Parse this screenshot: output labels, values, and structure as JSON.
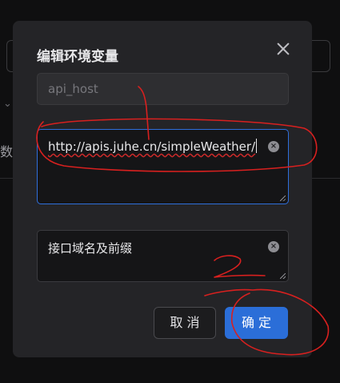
{
  "dialog": {
    "title": "编辑环境变量",
    "key_field": {
      "value": "api_host"
    },
    "value_field": {
      "value": "http://apis.juhe.cn/simpleWeather/"
    },
    "description_field": {
      "value": "接口域名及前缀"
    },
    "cancel_label": "取 消",
    "confirm_label": "确 定"
  },
  "background": {
    "partial_text": "数"
  },
  "annotations": {
    "mark_1": "1",
    "mark_2": "2"
  },
  "colors": {
    "accent": "#2b6ed8",
    "annotation": "#d8201f"
  }
}
